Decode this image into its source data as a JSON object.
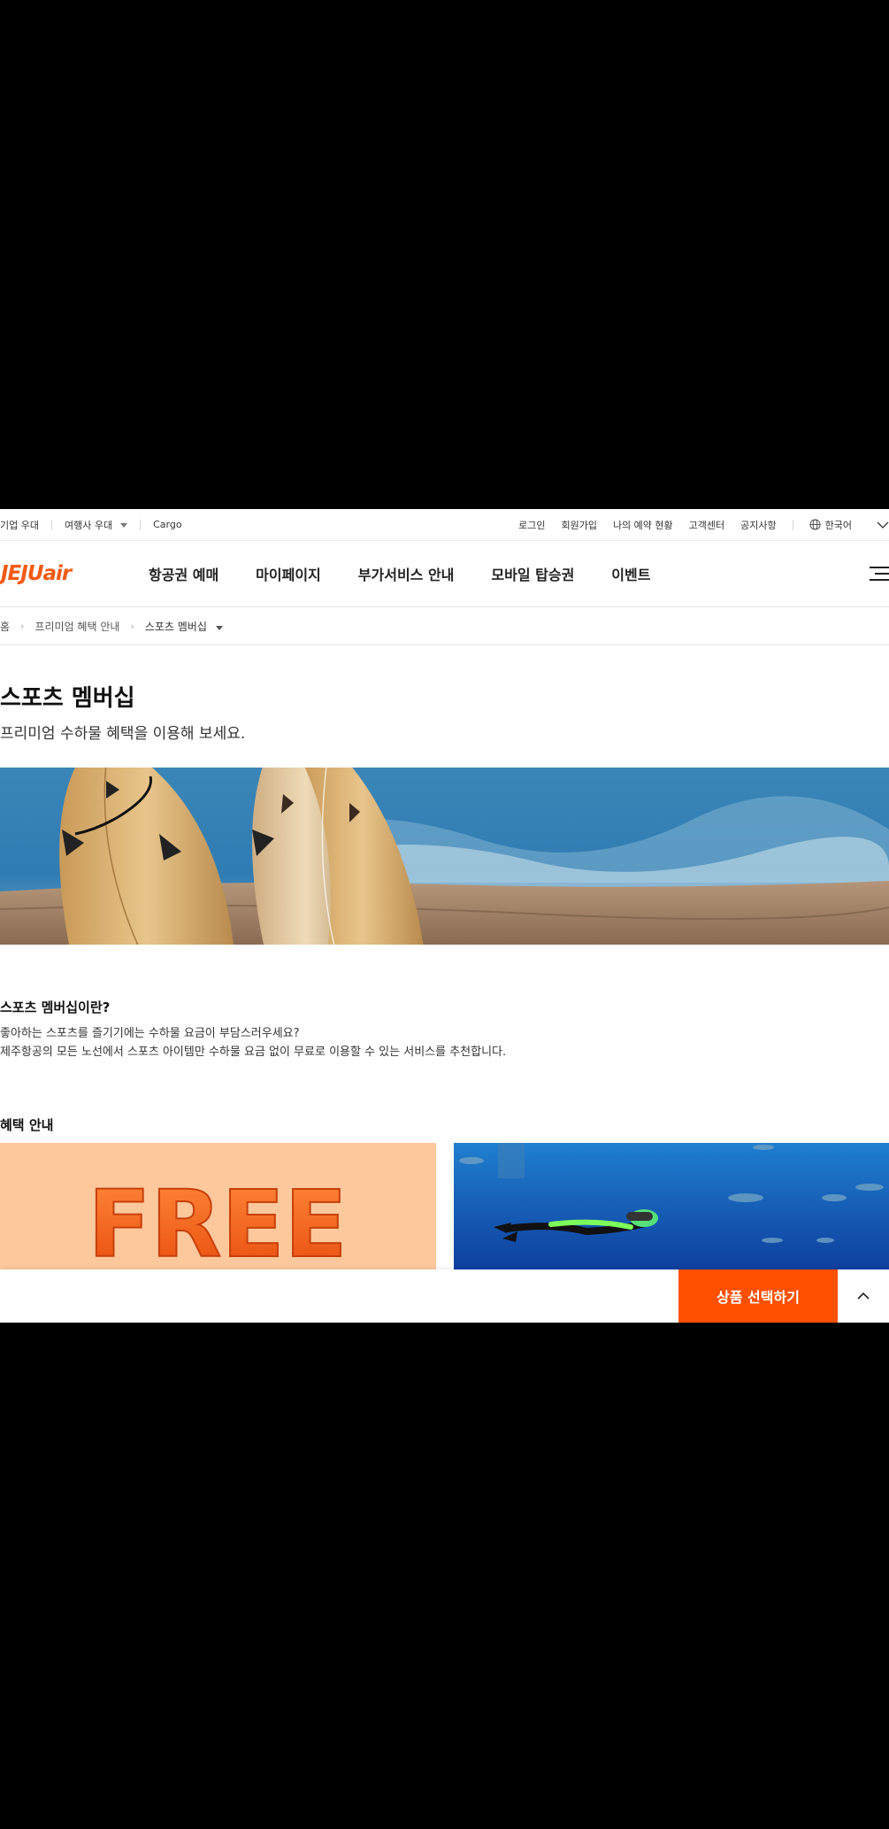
{
  "utility": {
    "corporate": "기업 우대",
    "travel_agency": "여행사 우대",
    "cargo": "Cargo",
    "login": "로그인",
    "signup": "회원가입",
    "my_reservation": "나의 예약 현황",
    "customer_center": "고객센터",
    "notice": "공지사항",
    "language": "한국어"
  },
  "gnb": {
    "logo": "JEJUair",
    "menu": [
      "항공권 예매",
      "마이페이지",
      "부가서비스 안내",
      "모바일 탑승권",
      "이벤트"
    ]
  },
  "breadcrumb": [
    "홈",
    "프리미엄 혜택 안내",
    "스포츠 멤버십"
  ],
  "page": {
    "title": "스포츠 멤버십",
    "subtitle": "프리미엄 수하물 혜택을 이용해 보세요."
  },
  "about": {
    "heading": "스포츠 멤버십이란?",
    "lines": [
      "좋아하는 스포츠를 즐기기에는 수하물 요금이 부담스러우세요?",
      "제주항공의 모든 노선에서 스포츠 아이템만 수하물 요금 없이 무료로 이용할 수 있는 서비스를 추천합니다."
    ]
  },
  "benefits": {
    "heading": "혜택 안내",
    "card1_text": "FREE"
  },
  "bottom": {
    "cta": "상품 선택하기"
  },
  "colors": {
    "brand": "#ff5000",
    "logo": "#f25a14"
  }
}
